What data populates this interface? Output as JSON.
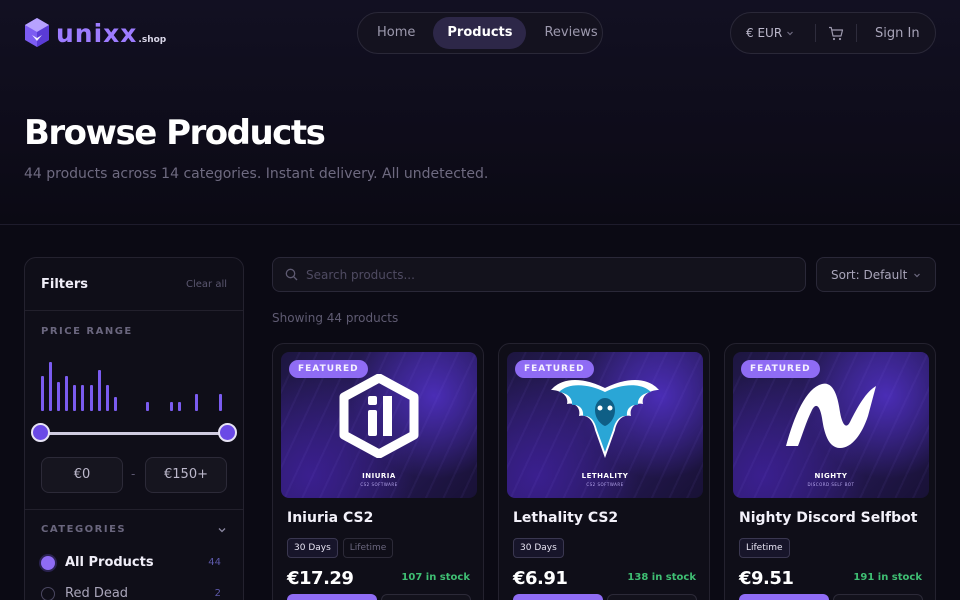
{
  "brand": {
    "name": "unixx",
    "suffix": ".shop",
    "accent": "#8f6cf4"
  },
  "nav": {
    "items": [
      "Home",
      "Products",
      "Reviews"
    ],
    "active": "Products"
  },
  "topbar": {
    "currency": "€ EUR",
    "cart_icon": "cart-icon",
    "signin": "Sign In"
  },
  "page": {
    "title": "Browse Products",
    "subtitle": "44 products across 14 categories. Instant delivery. All undetected."
  },
  "filters": {
    "title": "Filters",
    "clear": "Clear all",
    "price_label": "PRICE RANGE",
    "price_histogram": [
      0.6,
      0.85,
      0.5,
      0.6,
      0.45,
      0.45,
      0.45,
      0.7,
      0.45,
      0.25,
      0,
      0,
      0,
      0.15,
      0,
      0,
      0.15,
      0.15,
      0,
      0.3,
      0,
      0,
      0.3
    ],
    "price_min": "€0",
    "price_max": "€150+",
    "slider_range": [
      0,
      1
    ],
    "categories_label": "CATEGORIES",
    "categories": [
      {
        "name": "All Products",
        "count": "44",
        "selected": true
      },
      {
        "name": "Red Dead",
        "count": "2",
        "selected": false
      }
    ]
  },
  "search": {
    "placeholder": "Search products..."
  },
  "sort": {
    "label": "Sort: Default"
  },
  "showing": "Showing 44 products",
  "products": [
    {
      "badge": "FEATURED",
      "name": "Iniuria CS2",
      "image_title": "INIURIA",
      "image_sub": "CS2 SOFTWARE",
      "tags": [
        "30 Days",
        "Lifetime"
      ],
      "tag_states": [
        "active",
        "dim"
      ],
      "price": "€17.29",
      "stock": "107 in stock",
      "logo": "hexagon-i-logo"
    },
    {
      "badge": "FEATURED",
      "name": "Lethality CS2",
      "image_title": "LETHALITY",
      "image_sub": "CS2 SOFTWARE",
      "tags": [
        "30 Days"
      ],
      "tag_states": [
        "active"
      ],
      "price": "€6.91",
      "stock": "138 in stock",
      "logo": "eagle-logo"
    },
    {
      "badge": "FEATURED",
      "name": "Nighty Discord Selfbot",
      "image_title": "NIGHTY",
      "image_sub": "DISCORD SELF BOT",
      "tags": [
        "Lifetime"
      ],
      "tag_states": [
        "active"
      ],
      "price": "€9.51",
      "stock": "191 in stock",
      "logo": "n-wave-logo"
    }
  ]
}
